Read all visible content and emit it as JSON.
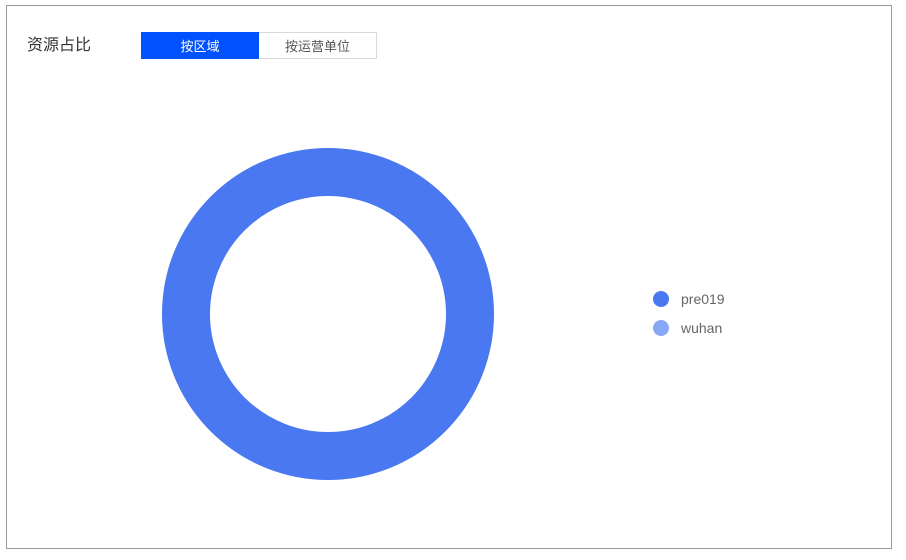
{
  "panel": {
    "title": "资源占比",
    "tabs": [
      {
        "label": "按区域",
        "active": true
      },
      {
        "label": "按运营单位",
        "active": false
      }
    ]
  },
  "colors": {
    "accent": "#0052ff",
    "series": [
      "#4a78f0",
      "#8aa6f7"
    ]
  },
  "chart_data": {
    "type": "pie",
    "donut": true,
    "legend_position": "right",
    "categories": [
      "pre019",
      "wuhan"
    ],
    "values": [
      100,
      0
    ]
  }
}
